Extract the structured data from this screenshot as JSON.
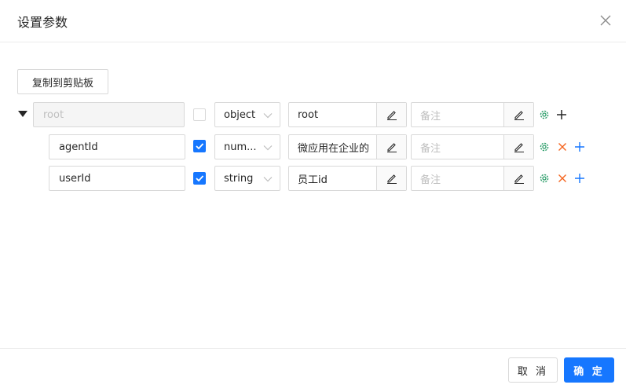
{
  "dialog": {
    "title": "设置参数",
    "copy_button": "复制到剪贴板",
    "cancel_button": "取 消",
    "ok_button": "确 定"
  },
  "colors": {
    "primary": "#1677ff",
    "gear": "#2e9e6b",
    "delete": "#f5641e",
    "add_child": "#1677ff"
  },
  "rows": [
    {
      "name": "root",
      "required": false,
      "type": "object",
      "title_value": "root",
      "remark_placeholder": "备注",
      "actions": [
        "gear-icon",
        "plus-icon"
      ]
    },
    {
      "name": "agentId",
      "required": true,
      "type": "num...",
      "title_value": "微应用在企业的",
      "remark_placeholder": "备注",
      "actions": [
        "gear-icon",
        "delete-icon",
        "plus-icon"
      ]
    },
    {
      "name": "userId",
      "required": true,
      "type": "string",
      "title_value": "员工id",
      "remark_placeholder": "备注",
      "actions": [
        "gear-icon",
        "delete-icon",
        "plus-icon"
      ]
    }
  ]
}
